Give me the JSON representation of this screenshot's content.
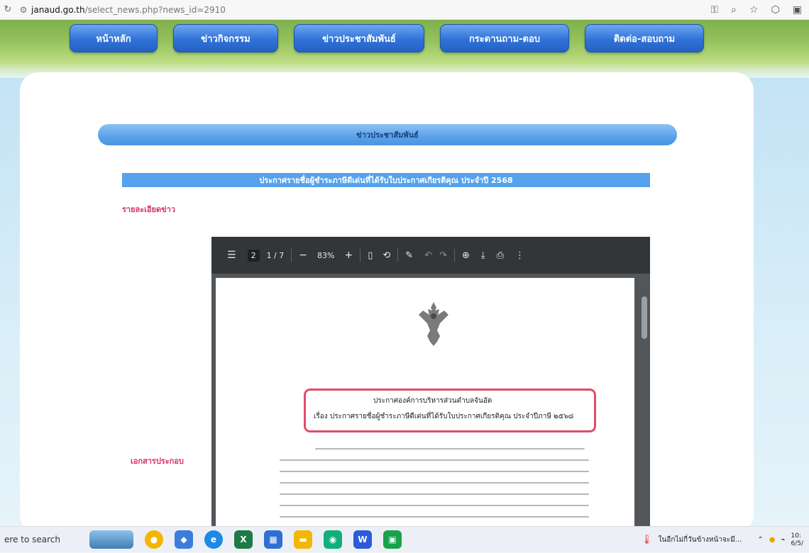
{
  "browser": {
    "url_host": "janaud.go.th",
    "url_path": "/select_news.php?news_id=2910"
  },
  "nav": {
    "items": [
      "หน้าหลัก",
      "ข่าวกิจกรรม",
      "ข่าวประชาสัมพันธ์",
      "กระดานถาม-ตอบ",
      "ติดต่อ-สอบถาม"
    ]
  },
  "section": {
    "header": "ข่าวประชาสัมพันธ์"
  },
  "news": {
    "title": "ประกาศรายชื่อผู้ชำระภาษีดีเด่นที่ได้รับใบประกาศเกียรติคุณ ประจำปี 2568",
    "detail_label": "รายละเอียดข่าว",
    "attachment_label": "เอกสารประกอบ"
  },
  "pdf_viewer": {
    "page_box": "2",
    "page_counter": "1 / 7",
    "zoom": "83%",
    "doc_heading_1": "ประกาศองค์การบริหารส่วนตำบลจันอัด",
    "doc_heading_2": "เรื่อง ประกาศรายชื่อผู้ชำระภาษีดีเด่นที่ได้รับใบประกาศเกียรติคุณ ประจำปีภาษี ๒๕๖๘"
  },
  "taskbar": {
    "search_text": "ere to search",
    "notification_text": "ในอีกไม่กี่วันข้างหน้าจะมี..."
  }
}
